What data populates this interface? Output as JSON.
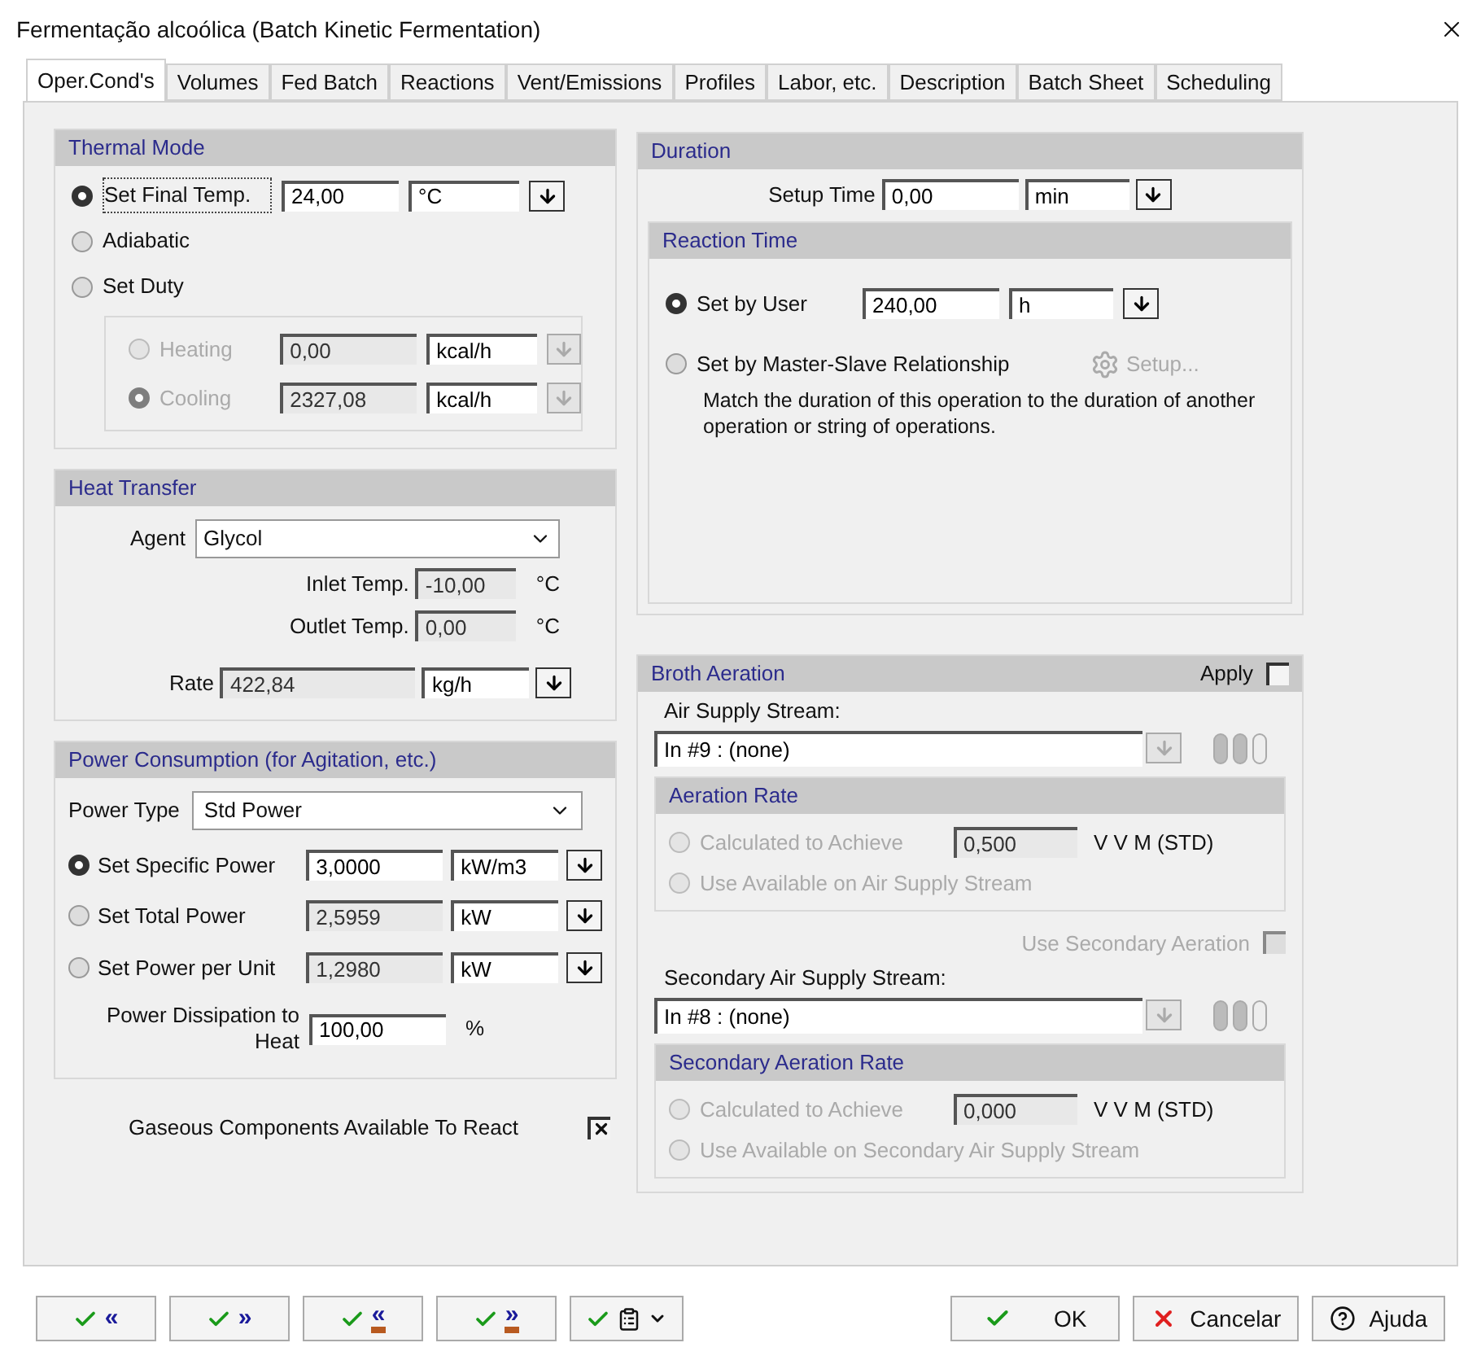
{
  "window": {
    "title": "Fermentação alcoólica (Batch Kinetic Fermentation)"
  },
  "tabs": [
    {
      "label": "Oper.Cond's",
      "selected": true
    },
    {
      "label": "Volumes",
      "selected": false
    },
    {
      "label": "Fed Batch",
      "selected": false
    },
    {
      "label": "Reactions",
      "selected": false
    },
    {
      "label": "Vent/Emissions",
      "selected": false
    },
    {
      "label": "Profiles",
      "selected": false
    },
    {
      "label": "Labor, etc.",
      "selected": false
    },
    {
      "label": "Description",
      "selected": false
    },
    {
      "label": "Batch Sheet",
      "selected": false
    },
    {
      "label": "Scheduling",
      "selected": false
    }
  ],
  "thermal_mode": {
    "title": "Thermal Mode",
    "options": [
      {
        "label": "Set Final Temp.",
        "selected": true,
        "value": "24,00",
        "unit": "°C"
      },
      {
        "label": "Adiabatic",
        "selected": false
      },
      {
        "label": "Set Duty",
        "selected": false
      }
    ],
    "duty": [
      {
        "label": "Heating",
        "selected": false,
        "disabled": true,
        "value": "0,00",
        "unit": "kcal/h"
      },
      {
        "label": "Cooling",
        "selected": true,
        "disabled": true,
        "value": "2327,08",
        "unit": "kcal/h"
      }
    ]
  },
  "heat_transfer": {
    "title": "Heat Transfer",
    "agent_label": "Agent",
    "agent": "Glycol",
    "inlet_label": "Inlet Temp.",
    "inlet": "-10,00",
    "inlet_unit": "°C",
    "outlet_label": "Outlet Temp.",
    "outlet": "0,00",
    "outlet_unit": "°C",
    "rate_label": "Rate",
    "rate": "422,84",
    "rate_unit": "kg/h"
  },
  "power": {
    "title": "Power Consumption (for Agitation, etc.)",
    "type_label": "Power Type",
    "type": "Std Power",
    "options": [
      {
        "label": "Set Specific Power",
        "selected": true,
        "value": "3,0000",
        "unit": "kW/m3"
      },
      {
        "label": "Set Total Power",
        "selected": false,
        "value": "2,5959",
        "unit": "kW"
      },
      {
        "label": "Set Power per Unit",
        "selected": false,
        "value": "1,2980",
        "unit": "kW"
      }
    ],
    "dissipation_label": "Power Dissipation to Heat",
    "dissipation": "100,00",
    "dissipation_unit": "%"
  },
  "gaseous": {
    "label": "Gaseous Components Available To React",
    "checked": true
  },
  "duration": {
    "title": "Duration",
    "setup_label": "Setup Time",
    "setup": "0,00",
    "setup_unit": "min",
    "reaction": {
      "title": "Reaction Time",
      "user_label": "Set by User",
      "user_selected": true,
      "user_value": "240,00",
      "user_unit": "h",
      "master_label": "Set by Master-Slave Relationship",
      "master_selected": false,
      "setup_button": "Setup...",
      "note": "Match the duration of this operation to the duration of another operation or string of operations."
    }
  },
  "aeration": {
    "title": "Broth Aeration",
    "apply_label": "Apply",
    "apply_checked": false,
    "streams": [
      {
        "label": "Air Supply Stream:",
        "stream": "In #9 : (none)",
        "rate_title": "Aeration Rate",
        "calc_label": "Calculated to Achieve",
        "calc_selected": false,
        "value": "0,500",
        "unit": "V V M (STD)",
        "use_label": "Use Available on Air Supply Stream",
        "use_selected": false
      },
      {
        "label": "Secondary Air Supply Stream:",
        "stream": "In #8 : (none)",
        "rate_title": "Secondary Aeration Rate",
        "calc_label": "Calculated to Achieve",
        "calc_selected": false,
        "value": "0,000",
        "unit": "V V M (STD)",
        "use_label": "Use Available on Secondary Air Supply Stream",
        "use_selected": false
      }
    ],
    "secondary_label": "Use Secondary Aeration",
    "secondary_checked": false
  },
  "nav_buttons": [
    {
      "kind": "plain",
      "label": "«"
    },
    {
      "kind": "plain",
      "label": "»"
    },
    {
      "kind": "bar",
      "label": "«"
    },
    {
      "kind": "bar",
      "label": "»"
    },
    {
      "kind": "menu"
    }
  ],
  "actions": [
    {
      "kind": "ok",
      "label": "OK"
    },
    {
      "kind": "cancel",
      "label": "Cancelar"
    },
    {
      "kind": "help",
      "label": "Ajuda"
    }
  ]
}
